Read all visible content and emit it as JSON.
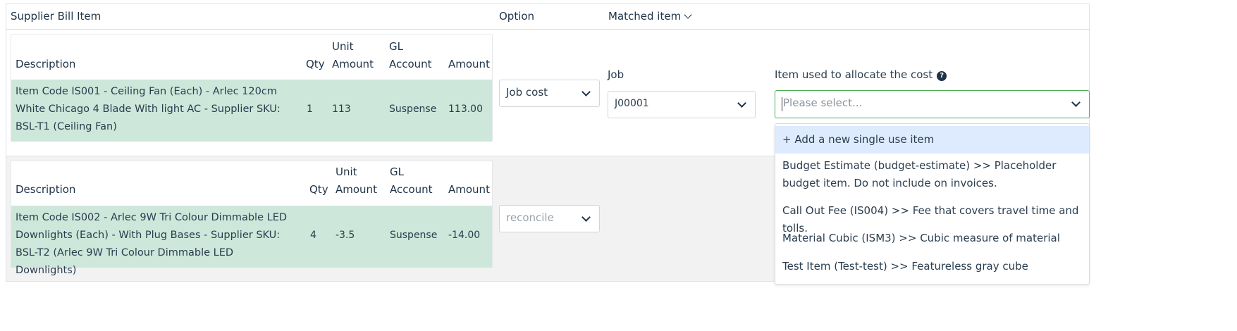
{
  "header": {
    "col_supplier": "Supplier Bill Item",
    "col_option": "Option",
    "col_matched": "Matched item"
  },
  "bill_headers": {
    "description": "Description",
    "qty": "Qty",
    "unit_1": "Unit",
    "unit_2": "Amount",
    "gl_1": "GL",
    "gl_2": "Account",
    "amount": "Amount"
  },
  "rows": [
    {
      "description": "Item Code IS001 - Ceiling Fan (Each) - Arlec 120cm White Chicago 4 Blade With light AC - Supplier SKU: BSL-T1 (Ceiling Fan)",
      "qty": "1",
      "unit_amount": "113",
      "gl_account": "Suspense",
      "amount": "113.00",
      "option": "Job cost"
    },
    {
      "description": "Item Code IS002 - Arlec 9W Tri Colour Dimmable LED Downlights (Each) - With Plug Bases - Supplier SKU: BSL-T2 (Arlec 9W Tri Colour Dimmable LED Downlights)",
      "qty": "4",
      "unit_amount": "-3.5",
      "gl_account": "Suspense",
      "amount": "-14.00",
      "option": "reconcile"
    }
  ],
  "job": {
    "label": "Job",
    "value": "J00001"
  },
  "allocation": {
    "label": "Item used to allocate the cost",
    "help_icon": "?",
    "placeholder": "Please select...",
    "options": [
      "+ Add a new single use item",
      "Budget Estimate (budget-estimate) >> Placeholder budget item. Do not include on invoices.",
      "Call Out Fee (IS004) >> Fee that covers travel time and tolls.",
      "Material Cubic (ISM3) >> Cubic measure of material",
      "Test Item (Test-test) >> Featureless gray cube"
    ]
  }
}
